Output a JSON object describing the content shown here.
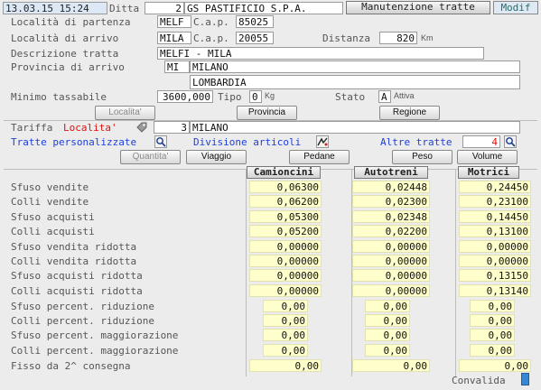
{
  "header": {
    "date": "13.03.15 15:24",
    "ditta_label": "Ditta",
    "ditta_code": "2",
    "ditta_name": "GS PASTIFICIO S.P.A.",
    "title": "Manutenzione tratte",
    "mode": "Modif"
  },
  "form": {
    "partenza_label": "Località di partenza",
    "partenza_code": "MELF",
    "cap_label": "C.a.p.",
    "partenza_cap": "85025",
    "arrivo_label": "Località di arrivo",
    "arrivo_code": "MILA",
    "arrivo_cap": "20055",
    "distanza_label": "Distanza",
    "distanza_value": "820",
    "distanza_unit": "Km",
    "descrizione_label": "Descrizione tratta",
    "descrizione_value": "MELFI - MILA",
    "provincia_label": "Provincia di arrivo",
    "provincia_code": "MI",
    "provincia_name": "MILANO",
    "regione_name": "LOMBARDIA",
    "minimo_label": "Minimo tassabile",
    "minimo_value": "3600,000",
    "tipo_label": "Tipo",
    "tipo_value": "0",
    "tipo_unit": "Kg",
    "stato_label": "Stato",
    "stato_value": "A",
    "stato_desc": "Attiva"
  },
  "buttons": {
    "localita": "Localita'",
    "provincia": "Provincia",
    "regione": "Regione",
    "quantita": "Quantita'",
    "viaggio": "Viaggio",
    "pedane": "Pedane",
    "peso": "Peso",
    "volume": "Volume"
  },
  "tariffa": {
    "label": "Tariffa",
    "type": "Localita'",
    "code": "3",
    "name": "MILANO"
  },
  "links": {
    "tratte_personalizzate": "Tratte personalizzate",
    "divisione_articoli": "Divisione articoli",
    "altre_tratte": "Altre tratte",
    "altre_tratte_count": "4"
  },
  "grid": {
    "columns": [
      "Camioncini",
      "Autotreni",
      "Motrici"
    ],
    "rows": [
      {
        "label": "Sfuso vendite",
        "values": [
          "0,06300",
          "0,02448",
          "0,24450"
        ]
      },
      {
        "label": "Colli vendite",
        "values": [
          "0,06200",
          "0,02300",
          "0,23100"
        ]
      },
      {
        "label": "Sfuso acquisti",
        "values": [
          "0,05300",
          "0,02348",
          "0,14450"
        ]
      },
      {
        "label": "Colli acquisti",
        "values": [
          "0,05200",
          "0,02200",
          "0,13100"
        ]
      },
      {
        "label": "Sfuso vendita  ridotta",
        "values": [
          "0,00000",
          "0,00000",
          "0,00000"
        ]
      },
      {
        "label": "Colli vendita  ridotta",
        "values": [
          "0,00000",
          "0,00000",
          "0,00000"
        ]
      },
      {
        "label": "Sfuso acquisti ridotta",
        "values": [
          "0,00000",
          "0,00000",
          "0,13150"
        ]
      },
      {
        "label": "Colli acquisti ridotta",
        "values": [
          "0,00000",
          "0,00000",
          "0,13140"
        ]
      }
    ],
    "perc_rows": [
      {
        "label": "Sfuso percent. riduzione",
        "values": [
          "0,00",
          "0,00",
          "0,00"
        ]
      },
      {
        "label": "Colli percent. riduzione",
        "values": [
          "0,00",
          "0,00",
          "0,00"
        ]
      },
      {
        "label": "Sfuso percent. maggiorazione",
        "values": [
          "0,00",
          "0,00",
          "0,00"
        ]
      },
      {
        "label": "Colli percent. maggiorazione",
        "values": [
          "0,00",
          "0,00",
          "0,00"
        ]
      }
    ],
    "fisso_row": {
      "label": "Fisso da 2^ consegna",
      "values": [
        "0,00",
        "0,00",
        "0,00"
      ]
    }
  },
  "footer": {
    "convalida": "Convalida"
  }
}
